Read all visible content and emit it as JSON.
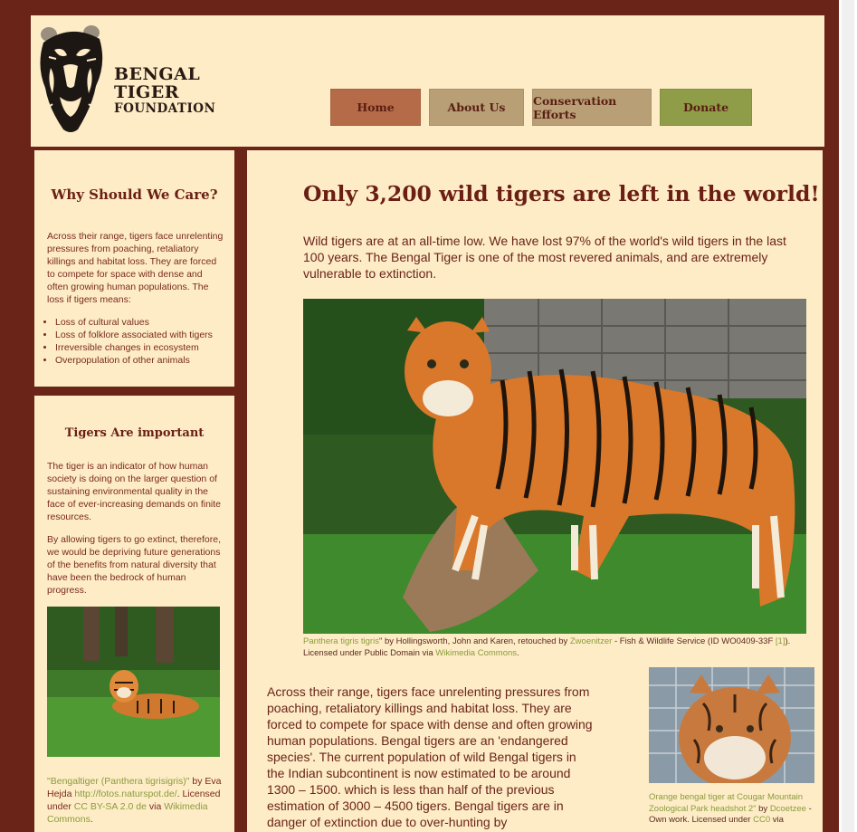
{
  "colors": {
    "frame": "#6b2418",
    "panel": "#fdecc6",
    "heading": "#6b1f14",
    "link": "#8c9b3e",
    "nav_home": "#b56b48",
    "nav_about": "#b89f76",
    "nav_conservation": "#b89f76",
    "nav_donate": "#8f9d48"
  },
  "logo": {
    "icon": "tiger-head-icon",
    "line1": "BENGAL",
    "line2": "TIGER",
    "line3": "FOUNDATION"
  },
  "nav": {
    "items": [
      {
        "label": "Home"
      },
      {
        "label": "About Us"
      },
      {
        "label": "Conservation Efforts"
      },
      {
        "label": "Donate"
      }
    ]
  },
  "sidebar": {
    "card1": {
      "title": "Why Should We Care?",
      "text": "Across their range, tigers face unrelenting pressures from poaching, retaliatory killings and habitat loss. They are forced to compete for space with dense and often growing human populations. The loss if tigers means:",
      "bullets": [
        "Loss of cultural values",
        "Loss of folklore associated with tigers",
        "Irreversible changes in ecosystem",
        "Overpopulation of other animals"
      ]
    },
    "card2": {
      "title": "Tigers Are important",
      "p1": "The tiger is an indicator of how human society is doing on the larger question of sustaining environmental quality in the face of ever-increasing demands on finite resources.",
      "p2": "By allowing tigers to go extinct, therefore, we would be depriving future generations of the benefits from natural diversity that have been the bedrock of human progress.",
      "image_alt": "tiger-lying-in-grass-photo",
      "credit": {
        "link1": "\"Bengaltiger (Panthera tigrisigris)\"",
        "t1": " by Eva Hejda ",
        "link2": "http://fotos.naturspot.de/",
        "t2": ". Licensed under ",
        "link3": "CC BY-SA 2.0 de",
        "t3": " via ",
        "link4": "Wikimedia Commons",
        "t4": "."
      }
    }
  },
  "main": {
    "headline": "Only 3,200 wild tigers are left in the world!",
    "intro": "Wild tigers are at an all-time low. We have lost 97% of the world's wild tigers in the last 100 years. The Bengal Tiger is one of the most revered animals, and are extremely vulnerable to extinction.",
    "hero_image": "standing-bengal-tiger-photo",
    "hero_caption": {
      "link1": "Panthera tigris tigris",
      "t1": "\" by Hollingsworth, John and Karen, retouched by ",
      "link2": "Zwoenitzer",
      "t2": " - Fish & Wildlife Service (ID WO0409-33F ",
      "link3": "[1]",
      "t3": "). Licensed under Public Domain via ",
      "link4": "Wikimedia Commons",
      "t4": "."
    },
    "body": "Across their range, tigers face unrelenting pressures from poaching, retaliatory killings and habitat loss. They are forced to compete for space with dense and often growing human populations. Bengal tigers are an 'endangered species'. The current population of wild Bengal tigers in the Indian subcontinent is now estimated to be around 1300 – 1500. which is less than half of the previous estimation of 3000 – 4500 tigers. Bengal tigers are in danger of extinction due to over-hunting by",
    "side_image": "orange-bengal-tiger-headshot-photo",
    "side_caption": {
      "link1": "Orange bengal tiger at Cougar Mountain Zoological Park headshot 2\"",
      "t1": " by ",
      "link2": "Dcoetzee",
      "t2": " - Own work. Licensed under ",
      "link3": "CC0",
      "t3": " via"
    }
  }
}
